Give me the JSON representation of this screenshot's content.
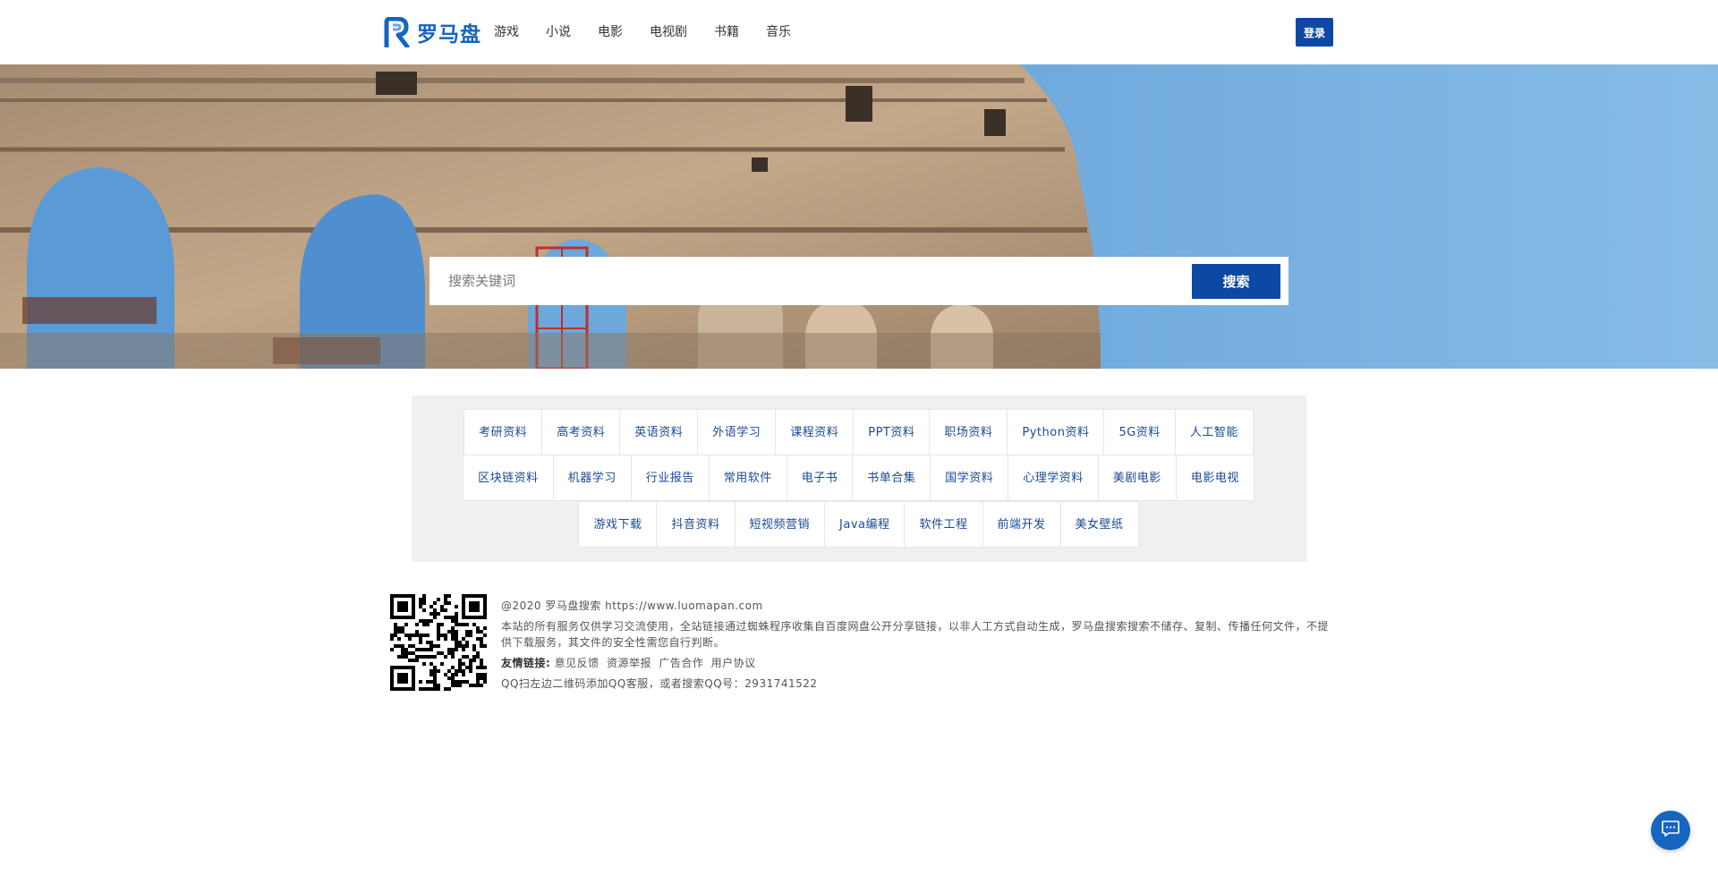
{
  "brand": {
    "name": "罗马盘",
    "logo_letter": "R",
    "color": "#1565c0"
  },
  "nav": {
    "items": [
      "游戏",
      "小说",
      "电影",
      "电视剧",
      "书籍",
      "音乐"
    ]
  },
  "header": {
    "login_label": "登录"
  },
  "search": {
    "placeholder": "搜索关键词",
    "button_label": "搜索"
  },
  "tags": {
    "rows": [
      [
        "考研资料",
        "高考资料",
        "英语资料",
        "外语学习",
        "课程资料",
        "PPT资料",
        "职场资料",
        "Python资料",
        "5G资料",
        "人工智能"
      ],
      [
        "区块链资料",
        "机器学习",
        "行业报告",
        "常用软件",
        "电子书",
        "书单合集",
        "国学资料",
        "心理学资料",
        "美剧电影",
        "电影电视"
      ],
      [
        "游戏下载",
        "抖音资料",
        "短视频营销",
        "Java编程",
        "软件工程",
        "前端开发",
        "美女壁纸"
      ]
    ]
  },
  "footer": {
    "copyright": "@2020 罗马盘搜索 https://www.luomapan.com",
    "disclaimer": "本站的所有服务仅供学习交流使用，全站链接通过蜘蛛程序收集自百度网盘公开分享链接，以非人工方式自动生成，罗马盘搜索搜索不储存、复制、传播任何文件，不提供下载服务，其文件的安全性需您自行判断。",
    "links_label": "友情链接:",
    "links": [
      "意见反馈",
      "资源举报",
      "广告合作",
      "用户协议"
    ],
    "qq_note": "QQ扫左边二维码添加QQ客服，或者搜索QQ号：2931741522"
  },
  "colors": {
    "primary": "#0b49a4",
    "tag_text": "#1a4a94",
    "panel_bg": "#f0f0f0"
  },
  "icons": {
    "chat": "chat-bubble-icon",
    "qr": "qr-code"
  }
}
